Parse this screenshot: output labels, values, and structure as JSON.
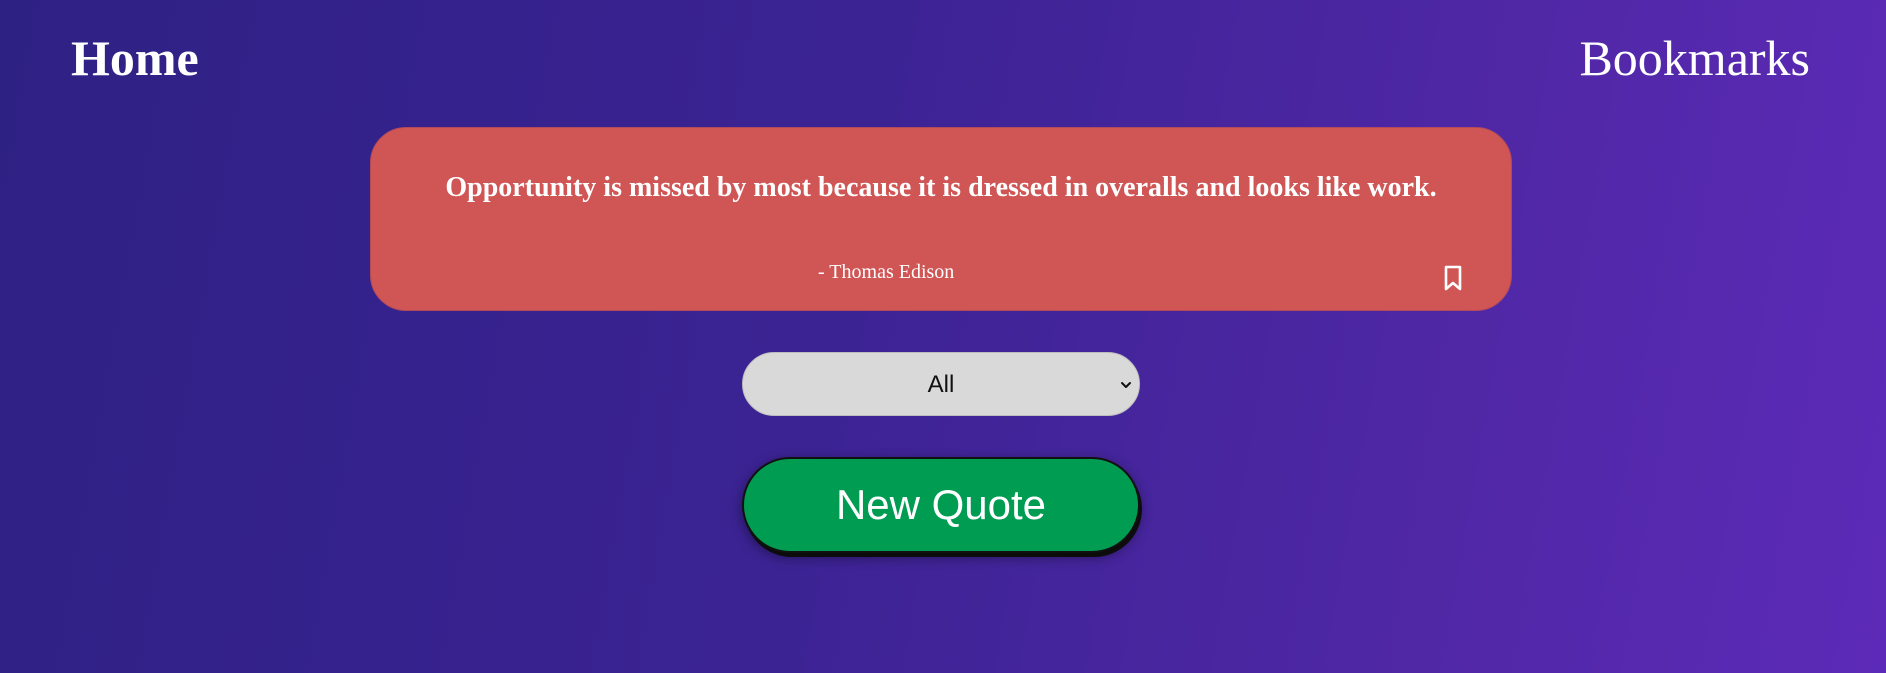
{
  "nav": {
    "home_label": "Home",
    "bookmarks_label": "Bookmarks"
  },
  "quote": {
    "text": "Opportunity is missed by most because it is dressed in overalls and looks like work.",
    "author": "- Thomas Edison",
    "bookmark_icon": "bookmark-outline-icon"
  },
  "category_select": {
    "selected": "All"
  },
  "actions": {
    "new_quote_label": "New Quote"
  },
  "colors": {
    "background_start": "#2e2184",
    "background_end": "#5c2ab8",
    "quote_card": "#d05555",
    "select_bg": "#d9d9d9",
    "new_quote_button": "#009c52"
  }
}
